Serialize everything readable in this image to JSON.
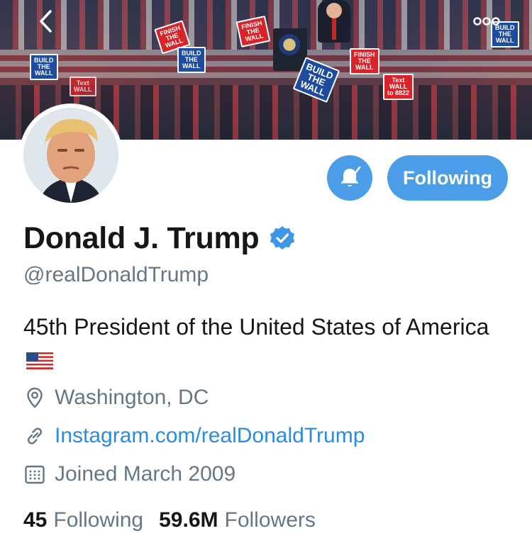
{
  "banner": {
    "signs": [
      "BUILD\nTHE\nWALL",
      "FINISH\nTHE\nWALL",
      "Text\nWALL\nto 8822",
      "BUILD\nTHE\nWALL",
      "FINISH\nTHE\nWALL",
      "BUILD\nTHE\nWALL",
      "Text\nWALL",
      "BUILD\nTHE\nWALL",
      "FINISH\nTHE\nWALL"
    ]
  },
  "nav": {
    "back_icon": "chevron-left-icon",
    "more_icon": "more-horizontal-icon"
  },
  "profile": {
    "display_name": "Donald J. Trump",
    "handle": "@realDonaldTrump",
    "verified": true,
    "bio": "45th President of the United States of America",
    "bio_flag": "us-flag-emoji",
    "location": "Washington, DC",
    "website": "Instagram.com/realDonaldTrump",
    "joined": "Joined March 2009"
  },
  "actions": {
    "notifications_icon": "bell-icon",
    "following_label": "Following"
  },
  "stats": {
    "following_count": "45",
    "following_label": "Following",
    "followers_count": "59.6M",
    "followers_label": "Followers"
  },
  "colors": {
    "accent": "#4a9de6",
    "link": "#2b8be0",
    "secondary_text": "#657786",
    "primary_text": "#14171a"
  }
}
